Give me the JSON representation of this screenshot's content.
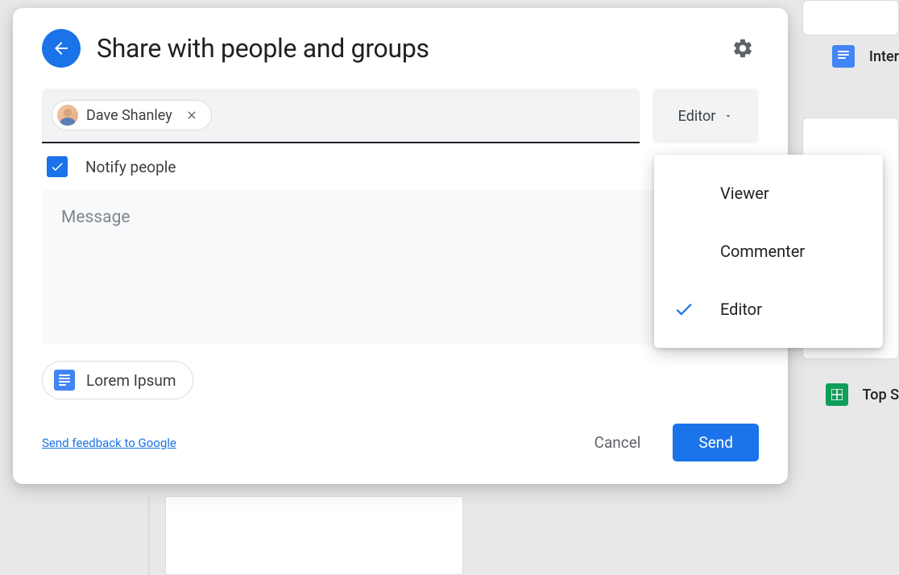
{
  "dialog": {
    "title": "Share with people and groups",
    "person_chip": {
      "name": "Dave Shanley"
    },
    "role_selected": "Editor",
    "notify_label": "Notify people",
    "message_placeholder": "Message",
    "attachment_name": "Lorem Ipsum",
    "feedback_link": "Send feedback to Google",
    "cancel_label": "Cancel",
    "send_label": "Send"
  },
  "role_menu": {
    "options": {
      "0": {
        "label": "Viewer",
        "checked": false
      },
      "1": {
        "label": "Commenter",
        "checked": false
      },
      "2": {
        "label": "Editor",
        "checked": true
      }
    }
  },
  "bg": {
    "file1_label": "Inter",
    "file2_label": "Top S"
  }
}
